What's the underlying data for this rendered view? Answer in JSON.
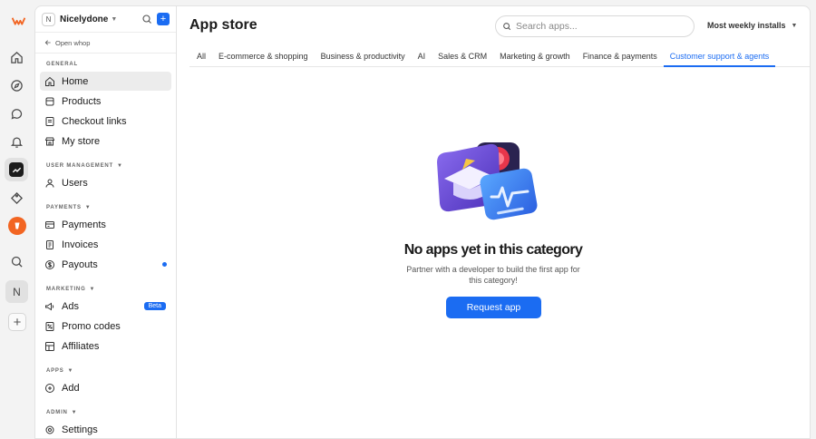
{
  "workspace": {
    "initial": "N",
    "name": "Nicelydone"
  },
  "rail": {
    "workspace_initial": "N"
  },
  "sidebar": {
    "open_whop": "Open whop",
    "sections": {
      "general": "GENERAL",
      "user_management": "USER MANAGEMENT",
      "payments": "PAYMENTS",
      "marketing": "MARKETING",
      "apps": "APPS",
      "admin": "ADMIN"
    },
    "items": {
      "home": "Home",
      "products": "Products",
      "checkout_links": "Checkout links",
      "my_store": "My store",
      "users": "Users",
      "payments": "Payments",
      "invoices": "Invoices",
      "payouts": "Payouts",
      "ads": "Ads",
      "ads_badge": "Beta",
      "promo_codes": "Promo codes",
      "affiliates": "Affiliates",
      "add": "Add",
      "settings": "Settings"
    }
  },
  "main": {
    "title": "App store",
    "search_placeholder": "Search apps...",
    "sort_label": "Most weekly installs",
    "tabs": [
      "All",
      "E-commerce & shopping",
      "Business & productivity",
      "AI",
      "Sales & CRM",
      "Marketing & growth",
      "Finance & payments",
      "Customer support & agents"
    ],
    "active_tab": "Customer support & agents",
    "empty": {
      "title": "No apps yet in this category",
      "subtitle": "Partner with a developer to build the first app for this category!",
      "cta": "Request app"
    }
  },
  "colors": {
    "accent": "#1b6cf2",
    "brand_orange": "#f26522",
    "illustration_purple": "#6a4fd6"
  }
}
